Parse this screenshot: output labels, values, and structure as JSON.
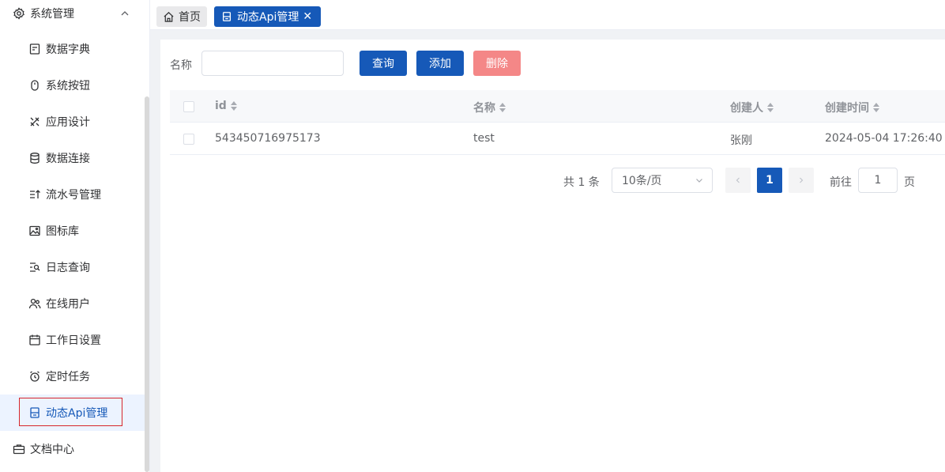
{
  "sidebar": {
    "group": {
      "label": "系统管理",
      "icon": "gear-icon"
    },
    "items": [
      {
        "label": "数据字典",
        "icon": "book-icon"
      },
      {
        "label": "系统按钮",
        "icon": "mouse-icon"
      },
      {
        "label": "应用设计",
        "icon": "design-icon"
      },
      {
        "label": "数据连接",
        "icon": "database-icon"
      },
      {
        "label": "流水号管理",
        "icon": "sort-list-icon"
      },
      {
        "label": "图标库",
        "icon": "image-icon"
      },
      {
        "label": "日志查询",
        "icon": "log-search-icon"
      },
      {
        "label": "在线用户",
        "icon": "users-icon"
      },
      {
        "label": "工作日设置",
        "icon": "calendar-icon"
      },
      {
        "label": "定时任务",
        "icon": "alarm-clock-icon"
      },
      {
        "label": "动态Api管理",
        "icon": "api-icon",
        "active": true
      }
    ],
    "bottom": {
      "label": "文档中心",
      "icon": "briefcase-icon"
    }
  },
  "tabs": {
    "home": {
      "label": "首页",
      "icon": "home-icon"
    },
    "active": {
      "label": "动态Api管理",
      "icon": "api-icon",
      "close": "✕"
    }
  },
  "search": {
    "label": "名称",
    "value": "",
    "placeholder": ""
  },
  "buttons": {
    "query": "查询",
    "add": "添加",
    "delete": "删除"
  },
  "table": {
    "headers": [
      "id",
      "名称",
      "创建人",
      "创建时间"
    ],
    "rows": [
      {
        "id": "543450716975173",
        "name": "test",
        "creator": "张刚",
        "created": "2024-05-04 17:26:40"
      }
    ]
  },
  "pagination": {
    "total": "共 1 条",
    "page_size": "10条/页",
    "current_page": "1",
    "goto_label": "前往",
    "goto_value": "1",
    "goto_unit": "页"
  },
  "colors": {
    "primary": "#1659b8",
    "danger": "#f48787",
    "active_bg": "#ecf3ff",
    "highlight_border": "#d6262b"
  }
}
